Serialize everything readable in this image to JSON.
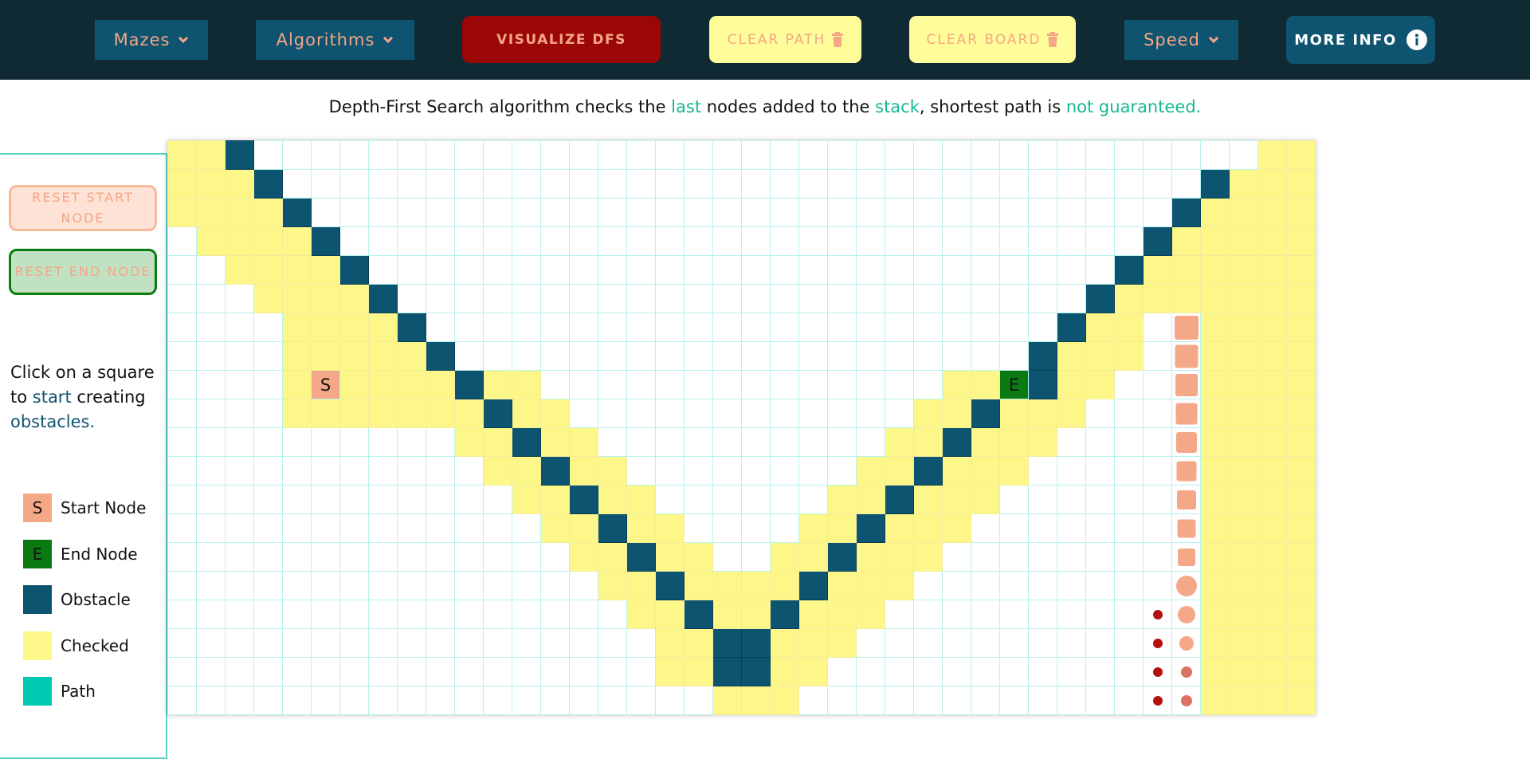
{
  "nav": {
    "mazes_label": "Mazes",
    "algorithms_label": "Algorithms",
    "visualize_label": "VISUALIZE DFS",
    "clear_path_label": "CLEAR PATH",
    "clear_board_label": "CLEAR BOARD",
    "speed_label": "Speed",
    "more_info_label": "MORE INFO"
  },
  "description": {
    "part1": "Depth-First Search algorithm checks the ",
    "hl1": "last",
    "part2": " nodes added to the ",
    "hl2": "stack",
    "part3": ", shortest path is ",
    "hl3": "not guaranteed."
  },
  "sidebar": {
    "reset_start_label": "RESET START NODE",
    "reset_end_label": "RESET END NODE",
    "instructions": {
      "part1": "Click on a square to ",
      "hl1": "start",
      "part2": " creating ",
      "hl2": "obstacles."
    },
    "legend": [
      {
        "symbol": "S",
        "label": "Start Node",
        "color": "#f5a887"
      },
      {
        "symbol": "E",
        "label": "End Node",
        "color": "#0b7a12"
      },
      {
        "symbol": "",
        "label": "Obstacle",
        "color": "#0d5470"
      },
      {
        "symbol": "",
        "label": "Checked",
        "color": "#fdf78a"
      },
      {
        "symbol": "",
        "label": "Path",
        "color": "#00c9b1"
      }
    ]
  },
  "grid": {
    "rows": 20,
    "cols": 40,
    "start_label": "S",
    "end_label": "E",
    "start": [
      8,
      5
    ],
    "end": [
      8,
      29
    ],
    "colors": {
      "obstacle": "#0d5470",
      "checked": "#fdf78a",
      "start": "#f5a887",
      "end": "#0b7a12",
      "animating": "#f5a887",
      "dot": "#b50f10"
    },
    "cell_rows": [
      "cc.w.......................................................................cc",
      "",
      "",
      "",
      "",
      "",
      "",
      "",
      "",
      "",
      "",
      "",
      "",
      "",
      "",
      "",
      "",
      "",
      "",
      ""
    ]
  }
}
